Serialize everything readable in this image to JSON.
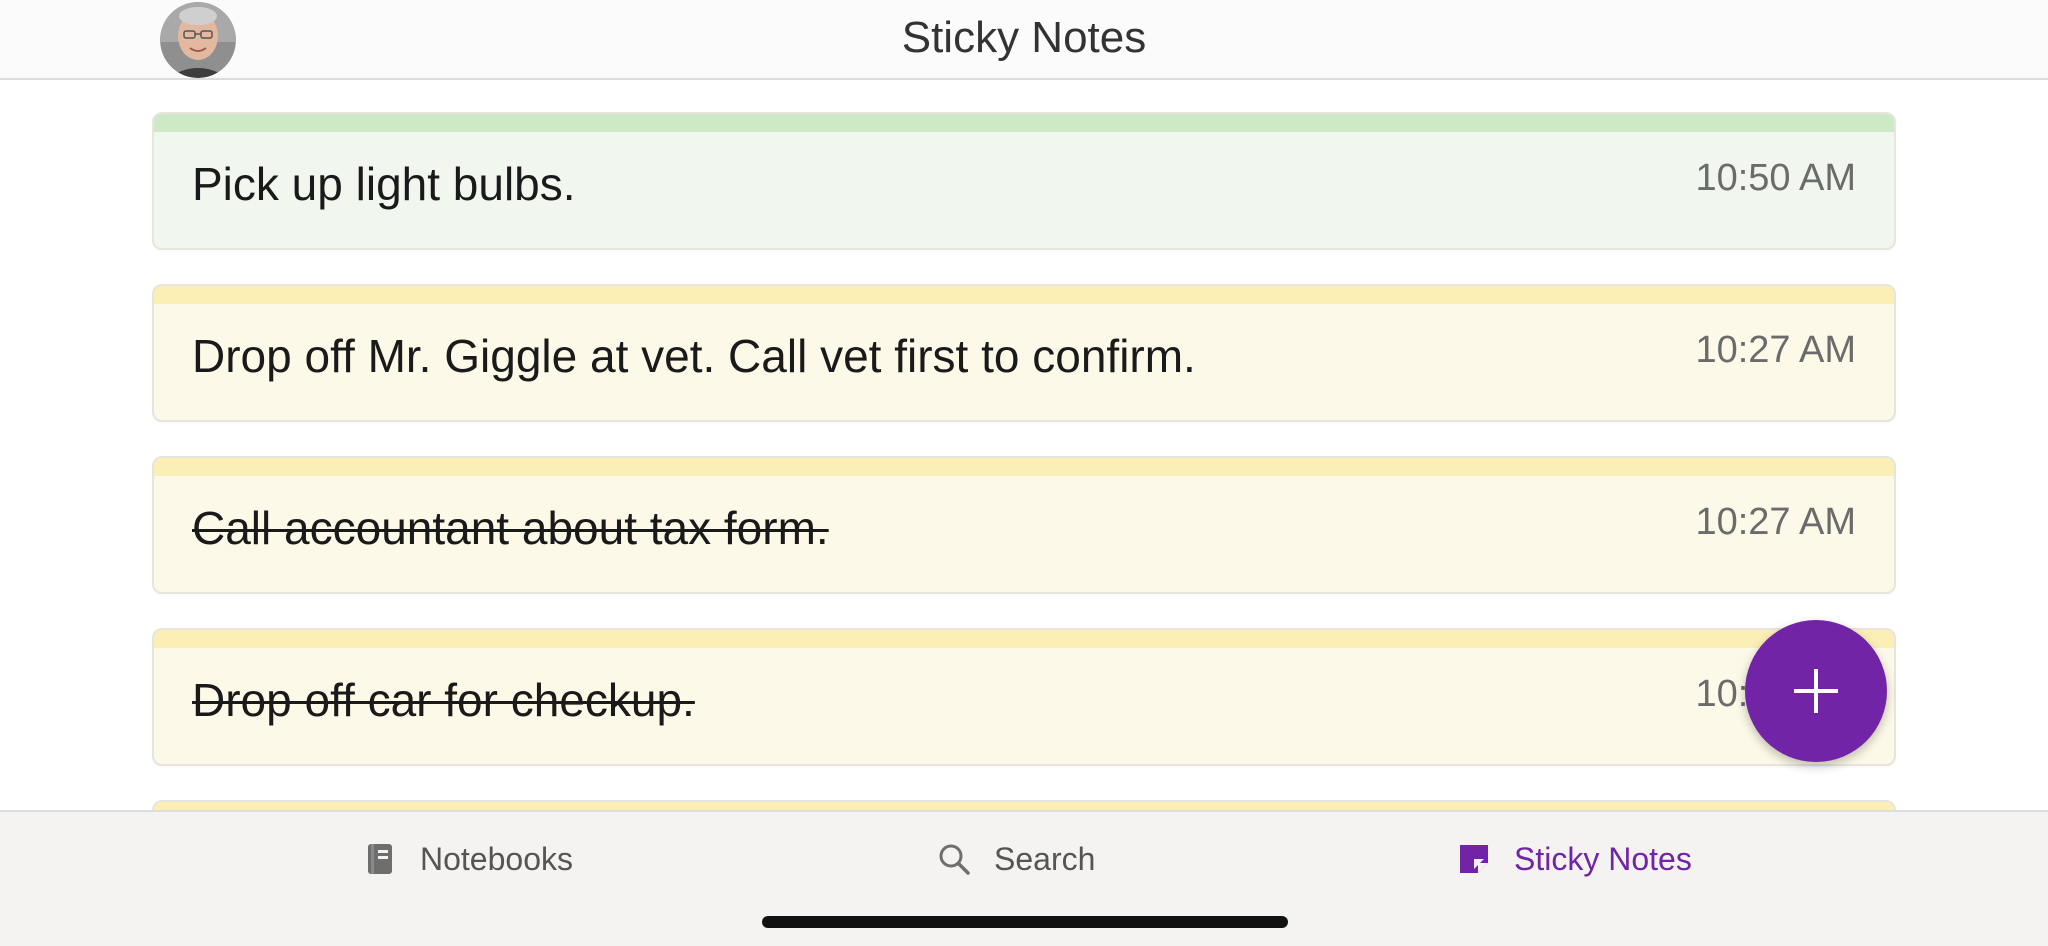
{
  "header": {
    "title": "Sticky Notes"
  },
  "notes": [
    {
      "text": "Pick up light bulbs.",
      "time": "10:50 AM",
      "bar_color": "#cde9c6",
      "bg_color": "#f1f7ef",
      "completed": false
    },
    {
      "text": "Drop off Mr. Giggle at vet. Call vet first to confirm.",
      "time": "10:27 AM",
      "bar_color": "#fbefb6",
      "bg_color": "#fdf9e8",
      "completed": false
    },
    {
      "text": "Call accountant about tax form.",
      "time": "10:27 AM",
      "bar_color": "#fbefb6",
      "bg_color": "#fdf9e8",
      "completed": true
    },
    {
      "text": "Drop off car for checkup.",
      "time": "10:27 AM",
      "bar_color": "#fbefb6",
      "bg_color": "#fdf9e8",
      "completed": true
    },
    {
      "text": "",
      "time": "",
      "bar_color": "#fbefb6",
      "bg_color": "#fdf9e8",
      "completed": false
    }
  ],
  "fab": {
    "icon": "plus-icon",
    "color": "#7224a6"
  },
  "tabbar": {
    "notebooks_label": "Notebooks",
    "search_label": "Search",
    "sticky_label": "Sticky Notes",
    "active_color": "#7224a6",
    "inactive_color": "#555555"
  }
}
